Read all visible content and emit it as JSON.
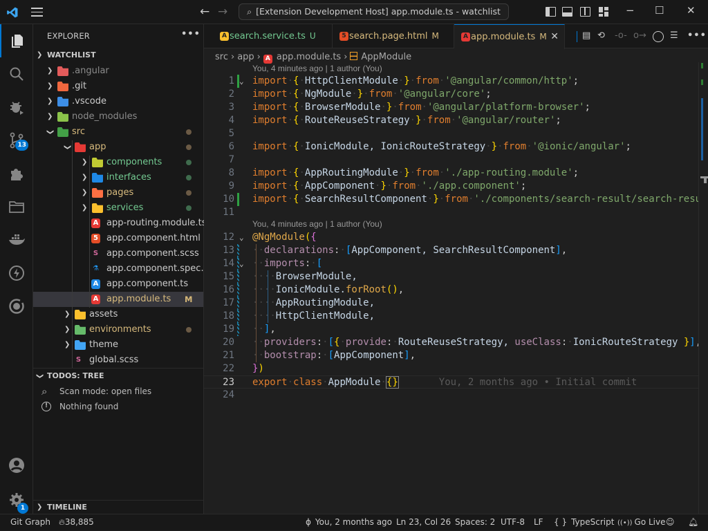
{
  "titlebar": {
    "command_center": "[Extension Development Host] app.module.ts - watchlist",
    "search_icon": "search-icon",
    "back_icon": "arrow-left-icon",
    "forward_icon": "arrow-right-icon",
    "minimize": "−",
    "maximize": "☐",
    "close": "✕"
  },
  "activity_bar": {
    "items": [
      {
        "name": "explorer",
        "icon": "files-icon",
        "active": true
      },
      {
        "name": "search",
        "icon": "search-icon"
      },
      {
        "name": "run-debug",
        "icon": "debug-icon"
      },
      {
        "name": "source-control",
        "icon": "source-control-icon",
        "badge": "13"
      },
      {
        "name": "extensions",
        "icon": "extensions-icon"
      },
      {
        "name": "project-manager",
        "icon": "folder-icon"
      },
      {
        "name": "docker",
        "icon": "docker-icon"
      },
      {
        "name": "thunder-client",
        "icon": "lightning-icon"
      },
      {
        "name": "ionic",
        "icon": "ionic-icon"
      }
    ],
    "bottom": [
      {
        "name": "accounts",
        "icon": "account-icon"
      },
      {
        "name": "manage",
        "icon": "gear-icon",
        "badge": "1"
      }
    ]
  },
  "sidebar": {
    "title": "EXPLORER",
    "more": "•••",
    "workspace": "WATCHLIST",
    "tree": [
      {
        "label": ".angular",
        "depth": 0,
        "type": "folder",
        "expanded": false,
        "color": "#8b8b8b",
        "icon_color": "#e35b5b"
      },
      {
        "label": ".git",
        "depth": 0,
        "type": "folder",
        "expanded": false,
        "color": "#cccccc",
        "icon_color": "#f0673e"
      },
      {
        "label": ".vscode",
        "depth": 0,
        "type": "folder",
        "expanded": false,
        "color": "#cccccc",
        "icon_color": "#3d8ee6"
      },
      {
        "label": "node_modules",
        "depth": 0,
        "type": "folder",
        "expanded": false,
        "color": "#8b8b8b",
        "icon_color": "#8bc34a"
      },
      {
        "label": "src",
        "depth": 0,
        "type": "folder",
        "expanded": true,
        "color": "#d7ba7d",
        "icon_color": "#43a047",
        "dot": "#6b5a45"
      },
      {
        "label": "app",
        "depth": 1,
        "type": "folder",
        "expanded": true,
        "color": "#d7ba7d",
        "icon_color": "#e53935",
        "dot": "#6b5a45"
      },
      {
        "label": "components",
        "depth": 2,
        "type": "folder",
        "expanded": false,
        "color": "#73c991",
        "icon_color": "#c0ca33",
        "dot": "#3f6b4d"
      },
      {
        "label": "interfaces",
        "depth": 2,
        "type": "folder",
        "expanded": false,
        "color": "#73c991",
        "icon_color": "#1e88e5",
        "dot": "#3f6b4d"
      },
      {
        "label": "pages",
        "depth": 2,
        "type": "folder",
        "expanded": false,
        "color": "#d7ba7d",
        "icon_color": "#ff7043",
        "dot": "#6b5a45"
      },
      {
        "label": "services",
        "depth": 2,
        "type": "folder",
        "expanded": false,
        "color": "#73c991",
        "icon_color": "#fbc02d",
        "dot": "#3f6b4d"
      },
      {
        "label": "app-routing.module.ts",
        "depth": 2,
        "type": "file",
        "color": "#cccccc",
        "icon": "A",
        "icon_color": "#e53935"
      },
      {
        "label": "app.component.html",
        "depth": 2,
        "type": "file",
        "color": "#cccccc",
        "icon": "5",
        "icon_color": "#e44d26"
      },
      {
        "label": "app.component.scss",
        "depth": 2,
        "type": "file",
        "color": "#cccccc",
        "icon": "S",
        "icon_color": "#cd6799"
      },
      {
        "label": "app.component.spec.ts",
        "depth": 2,
        "type": "file",
        "color": "#cccccc",
        "icon": "⚗",
        "icon_color": "#2196f3"
      },
      {
        "label": "app.component.ts",
        "depth": 2,
        "type": "file",
        "color": "#cccccc",
        "icon": "A",
        "icon_color": "#1e88e5"
      },
      {
        "label": "app.module.ts",
        "depth": 2,
        "type": "file",
        "color": "#d7ba7d",
        "icon": "A",
        "icon_color": "#e53935",
        "selected": true,
        "badge": "M"
      },
      {
        "label": "assets",
        "depth": 1,
        "type": "folder",
        "expanded": false,
        "color": "#cccccc",
        "icon_color": "#fbc02d"
      },
      {
        "label": "environments",
        "depth": 1,
        "type": "folder",
        "expanded": false,
        "color": "#d7ba7d",
        "icon_color": "#66bb6a",
        "dot": "#6b5a45"
      },
      {
        "label": "theme",
        "depth": 1,
        "type": "folder",
        "expanded": false,
        "color": "#cccccc",
        "icon_color": "#42a5f5"
      },
      {
        "label": "global.scss",
        "depth": 1,
        "type": "file",
        "color": "#cccccc",
        "icon": "S",
        "icon_color": "#cd6799"
      }
    ],
    "todos": {
      "title": "TODOS: TREE",
      "items": [
        {
          "icon": "search-icon",
          "label": "Scan mode: open files"
        },
        {
          "icon": "info-icon",
          "label": "Nothing found"
        }
      ]
    },
    "timeline": "TIMELINE"
  },
  "editor": {
    "tabs": [
      {
        "label": "search.service.ts",
        "status": "U",
        "color": "#73c991",
        "status_color": "#73c991",
        "icon": "A",
        "icon_color": "#fbc02d"
      },
      {
        "label": "search.page.html",
        "status": "M",
        "color": "#d7ba7d",
        "status_color": "#d7ba7d",
        "icon": "5",
        "icon_color": "#e44d26"
      },
      {
        "label": "app.module.ts",
        "status": "M",
        "color": "#d7ba7d",
        "status_color": "#d7ba7d",
        "icon": "A",
        "icon_color": "#e53935",
        "active": true
      }
    ],
    "breadcrumb": [
      "src",
      "app",
      "app.module.ts",
      "AppModule"
    ],
    "codelens": [
      "You, 4 minutes ago | 1 author (You)",
      "You, 4 minutes ago | 1 author (You)"
    ],
    "blame_inline": "You, 2 months ago • Initial commit",
    "lines": [
      "1",
      "2",
      "3",
      "4",
      "5",
      "6",
      "7",
      "8",
      "9",
      "10",
      "11",
      "12",
      "13",
      "14",
      "15",
      "16",
      "17",
      "18",
      "19",
      "20",
      "21",
      "22",
      "23",
      "24"
    ],
    "code": {
      "l1": [
        "import",
        "{",
        "HttpClientModule",
        "}",
        "from",
        "'@angular/common/http'",
        ";"
      ],
      "l2": [
        "import",
        "{",
        "NgModule",
        "}",
        "from",
        "'@angular/core'",
        ";"
      ],
      "l3": [
        "import",
        "{",
        "BrowserModule",
        "}",
        "from",
        "'@angular/platform-browser'",
        ";"
      ],
      "l4": [
        "import",
        "{",
        "RouteReuseStrategy",
        "}",
        "from",
        "'@angular/router'",
        ";"
      ],
      "l6": [
        "import",
        "{",
        "IonicModule, IonicRouteStrategy",
        "}",
        "from",
        "'@ionic/angular'",
        ";"
      ],
      "l8": [
        "import",
        "{",
        "AppRoutingModule",
        "}",
        "from",
        "'./app-routing.module'",
        ";"
      ],
      "l9": [
        "import",
        "{",
        "AppComponent",
        "}",
        "from",
        "'./app.component'",
        ";"
      ],
      "l10": [
        "import",
        "{",
        "SearchResultComponent",
        "}",
        "from",
        "'./components/search-result/search-result.component'",
        ";"
      ],
      "l12": [
        "@NgModule",
        "(",
        "{"
      ],
      "l13": [
        "declarations",
        ": ",
        "[",
        "AppComponent, SearchResultComponent",
        "]",
        ","
      ],
      "l14": [
        "imports",
        ": ",
        "["
      ],
      "l15": [
        "BrowserModule,"
      ],
      "l16": [
        "IonicModule.",
        "forRoot",
        "()",
        ","
      ],
      "l17": [
        "AppRoutingModule,"
      ],
      "l18": [
        "HttpClientModule,"
      ],
      "l19": [
        "]",
        ","
      ],
      "l20": [
        "providers",
        ": ",
        "[",
        "{",
        "provide",
        ": ",
        "RouteReuseStrategy, ",
        "useClass",
        ": ",
        "IonicRouteStrategy ",
        "}",
        "]",
        ","
      ],
      "l21": [
        "bootstrap",
        ": ",
        "[",
        "AppComponent",
        "]",
        ","
      ],
      "l22": [
        "}",
        ")"
      ],
      "l23": [
        "export",
        "class",
        "AppModule",
        "{}"
      ]
    }
  },
  "statusbar": {
    "git_graph": "Git Graph",
    "flame_count": "38,885",
    "blame": "You, 2 months ago",
    "position": "Ln 23, Col 26",
    "spaces": "Spaces: 2",
    "encoding": "UTF-8",
    "eol": "LF",
    "language": "TypeScript",
    "go_live": "Go Live"
  }
}
